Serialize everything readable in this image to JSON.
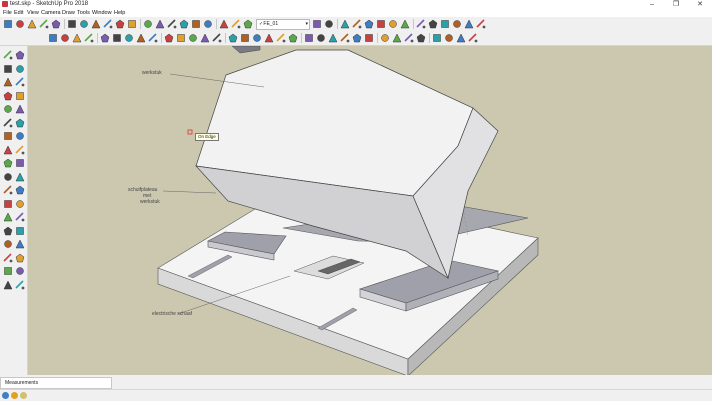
{
  "window": {
    "title": "test.skp - SketchUp Pro 2018",
    "app_icon": "sketchup-icon"
  },
  "window_controls": [
    {
      "name": "minimize-button",
      "glyph": "–"
    },
    {
      "name": "maximize-button",
      "glyph": "❐"
    },
    {
      "name": "close-button",
      "glyph": "✕"
    }
  ],
  "menu": [
    "File",
    "Edit",
    "View",
    "Camera",
    "Draw",
    "Tools",
    "Window",
    "Help"
  ],
  "layers": {
    "check": "✓",
    "current_layer": "FE_01"
  },
  "top_toolbar_icons": [
    "select-icon",
    "eraser-icon",
    "paint-bucket-icon",
    "move-icon",
    "rotate-icon",
    "scale-icon",
    "push-pull-icon",
    "offset-icon",
    "undo-icon",
    "redo-icon",
    "3d-warehouse-icon",
    "extension-warehouse-icon",
    "circle-icon",
    "polygon-icon",
    "box-icon",
    "cube-icon",
    "cylinder-icon",
    "text-icon",
    "styles-icon",
    "display-icon",
    "house-icon",
    "home-icon",
    "roof-icon",
    "window-icon",
    "section-icon",
    "tape-measure-icon",
    "follow-me-icon",
    "intersect-icon",
    "arrow-icon",
    "component-icon",
    "dimension-icon",
    "protractor-icon",
    "axes-icon",
    "help-icon"
  ],
  "second_toolbar_icons": [
    "pencil-icon",
    "eraser-icon",
    "line-icon",
    "arc-icon",
    "circle-icon",
    "rectangle-icon",
    "push-pull-icon",
    "rotate-icon",
    "follow-me-icon",
    "scale-icon",
    "flip-icon",
    "text-icon",
    "paint-icon",
    "camera-icon",
    "walk-icon",
    "look-around-icon",
    "position-camera-icon",
    "section-plane-icon",
    "dimension-icon",
    "tape-icon",
    "orbit-icon",
    "pan-icon",
    "zoom-icon",
    "zoom-extents-icon",
    "previous-view-icon",
    "next-view-icon",
    "standard-views-icon",
    "x-ray-icon",
    "back-edges-icon",
    "wireframe-icon",
    "hidden-line-icon",
    "shaded-icon",
    "shaded-texture-icon",
    "monochrome-icon"
  ],
  "left_toolbar_icons": [
    "select-icon",
    "component-icon",
    "paint-bucket-icon",
    "eraser-icon",
    "line-icon",
    "freehand-icon",
    "rectangle-icon",
    "rotated-rectangle-icon",
    "circle-icon",
    "polygon-icon",
    "arc-icon",
    "pie-icon",
    "2-point-arc-icon",
    "3-point-arc-icon",
    "push-pull-icon",
    "follow-me-icon",
    "move-icon",
    "rotate-icon",
    "scale-icon",
    "offset-icon",
    "tape-measure-icon",
    "dimension-icon",
    "protractor-icon",
    "text-icon",
    "axes-icon",
    "3d-text-icon",
    "orbit-icon",
    "pan-icon",
    "zoom-icon",
    "zoom-window-icon",
    "zoom-extents-icon",
    "previous-icon",
    "position-camera-icon",
    "look-around-icon",
    "walk-icon",
    "section-plane-icon"
  ],
  "scene": {
    "annotations": {
      "workpiece": "werkstuk",
      "sliding_table": [
        "schuifplateau",
        "met",
        "werkstuk"
      ],
      "saw_blade": "electrische schaaf"
    },
    "inference_tooltip": "On Edge"
  },
  "measurements": {
    "label": "Measurements"
  },
  "status_icons": [
    "info-icon",
    "geo-location-icon",
    "credits-icon"
  ],
  "colors": {
    "viewport_bg": "#cbc8af",
    "tooltip_bg": "#ffffe1",
    "platform_top": "#a7a7b0",
    "workpiece_face": "#f2f2f2"
  }
}
